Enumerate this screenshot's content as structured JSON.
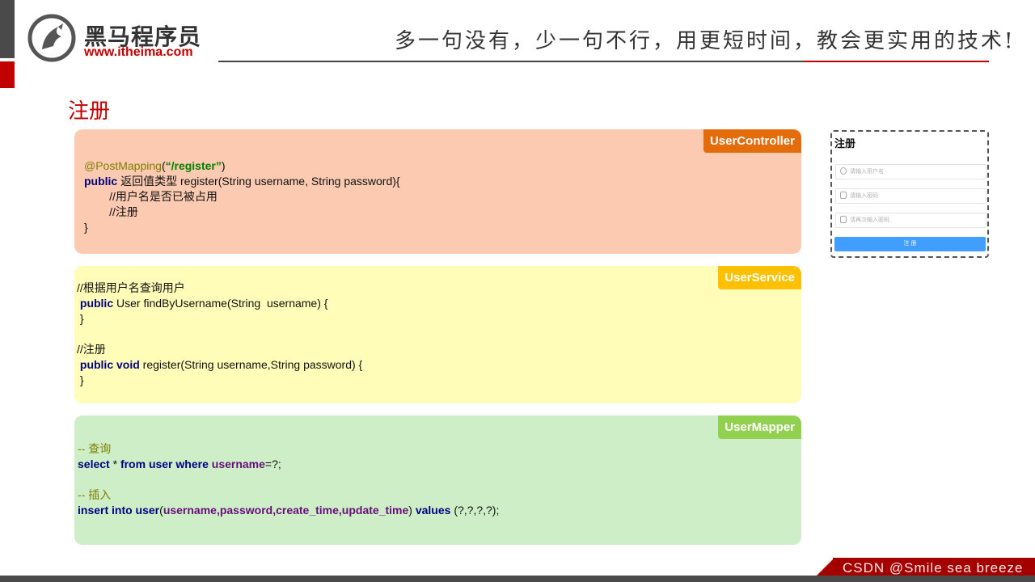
{
  "header": {
    "brand_cn": "黑马程序员",
    "brand_url": "www.itheima.com",
    "slogan": "多一句没有，少一句不行，用更短时间，教会更实用的技术!"
  },
  "section_title": "注册",
  "panels": {
    "controller": {
      "tag": "UserController",
      "lines": {
        "annotation": "@PostMapping",
        "paren_open": "(",
        "path": "“/register”",
        "paren_close": ")",
        "kw_public": "public",
        "sig": " 返回值类型 register(String username, String password){",
        "c1": "        //用户名是否已被占用",
        "c2": "        //注册",
        "close": "}"
      }
    },
    "service": {
      "tag": "UserService",
      "lines": {
        "c1": "//根据用户名查询用户",
        "kw1": "public",
        "s1": " User findByUsername(String  username) {",
        "close1": "}",
        "c2": "//注册",
        "kw2": "public void",
        "s2": " register(String username,String password) {",
        "close2": "}"
      }
    },
    "mapper": {
      "tag": "UserMapper",
      "lines": {
        "c1": "-- 查询",
        "sel": "select",
        "star": " * ",
        "from": "from user where",
        "uname": " username",
        "eq": "=?;",
        "c2": "-- 插入",
        "ins": "insert into user",
        "lp": "(",
        "cols": "username,password,create_time,update_time",
        "rp": ")",
        "vals": " values",
        "q": " (?,?,?,?);"
      }
    }
  },
  "form": {
    "title": "注册",
    "username_placeholder": "请输入用户名",
    "password_placeholder": "请输入密码",
    "repassword_placeholder": "请再次输入密码",
    "submit_label": "注 册",
    "button_color": "#409eff"
  },
  "footer": {
    "text": "CSDN @Smile sea breeze"
  },
  "colors": {
    "brand_red": "#c00000",
    "controller_bg": "#fcc9b1",
    "service_bg": "#fffdb8",
    "mapper_bg": "#ceeec7"
  }
}
